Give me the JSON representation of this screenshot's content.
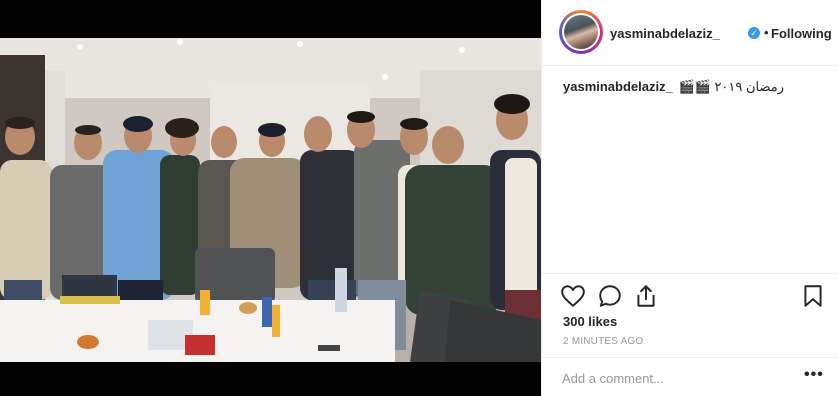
{
  "post": {
    "username": "yasminabdelaziz_",
    "verified_icon": "verified-badge-icon",
    "separator": "•",
    "follow_status": "Following",
    "caption": {
      "user": "yasminabdelaziz_",
      "text": "رمضان ٢٠١٩ 🎬🎬"
    },
    "likes": "300 likes",
    "time": "2 MINUTES AGO",
    "comment_placeholder": "Add a comment...",
    "more_label": "•••",
    "icons": {
      "like": "heart-icon",
      "comment": "comment-bubble-icon",
      "share": "share-icon",
      "save": "bookmark-icon"
    }
  }
}
